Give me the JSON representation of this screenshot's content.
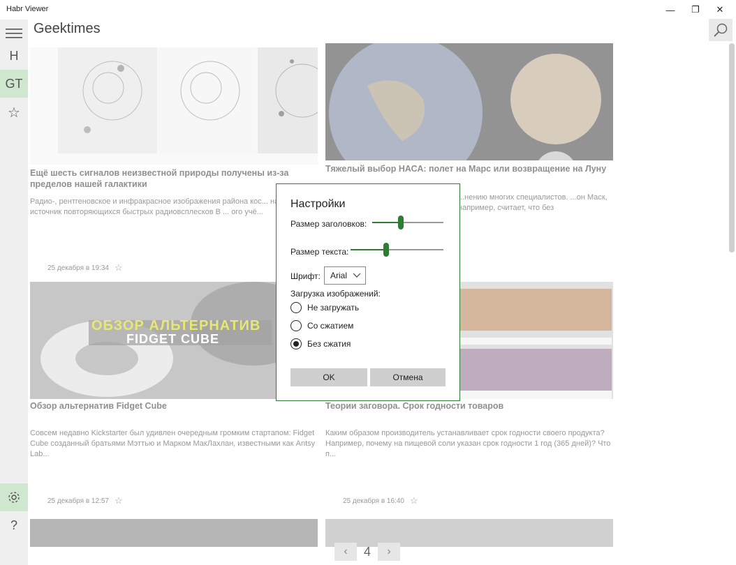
{
  "window": {
    "title": "Habr Viewer",
    "minimize": "—",
    "restore": "❐",
    "close": "✕"
  },
  "sidebar": {
    "items": [
      {
        "label": "H"
      },
      {
        "label": "GT"
      },
      {
        "label": "☆"
      }
    ],
    "settings_icon": "gear-icon",
    "help_label": "?"
  },
  "header": {
    "title": "Geektimes"
  },
  "articles": [
    {
      "title": "Ещё шесть сигналов неизвестной природы получены из-за пределов нашей галактики",
      "desc": "Радио-, рентгеновское и инфракрасное изображения района кос... находится источник повторяющихся быстрых радиовсплесков  В ... ого учё...",
      "date": "25 декабря в 19:34"
    },
    {
      "title": "Тяжелый выбор НАСА: полет на Марс или возвращение на Луну",
      "desc": "...нению многих специалистов. ...он Маск, например, считает, что без",
      "date": ""
    },
    {
      "title": "Обзор альтернатив Fidget Cube",
      "desc": "Совсем недавно Kickstarter был удивлен очередным громким стартапом: Fidget Cube созданный братьями Мэттью и Марком МакЛахлан, известными как Antsy Lab...",
      "date": "25 декабря в 12:57",
      "img_line1": "ОБЗОР АЛЬТЕРНАТИВ",
      "img_line2": "FIDGET CUBE"
    },
    {
      "title": "Теории заговора. Срок годности товаров",
      "desc": "Каким образом производитель устанавливает срок годности своего продукта? Например, почему на пищевой соли указан срок годности 1 год (365 дней)? Что п...",
      "date": "25 декабря в 16:40"
    }
  ],
  "dialog": {
    "title": "Настройки",
    "header_size_label": "Размер заголовков:",
    "header_size_value": 0.4,
    "text_size_label": "Размер текста:",
    "text_size_value": 0.38,
    "font_label": "Шрифт:",
    "font_value": "Arial",
    "images_label": "Загрузка изображений:",
    "options": [
      {
        "label": "Не загружать",
        "checked": false
      },
      {
        "label": "Со сжатием",
        "checked": false
      },
      {
        "label": "Без сжатия",
        "checked": true
      }
    ],
    "ok_label": "OK",
    "cancel_label": "Отмена"
  },
  "pager": {
    "page": "4",
    "prev": "‹",
    "next": "›"
  },
  "colors": {
    "accent": "#2e7d32",
    "sidebar_active": "#cfe6cf"
  }
}
